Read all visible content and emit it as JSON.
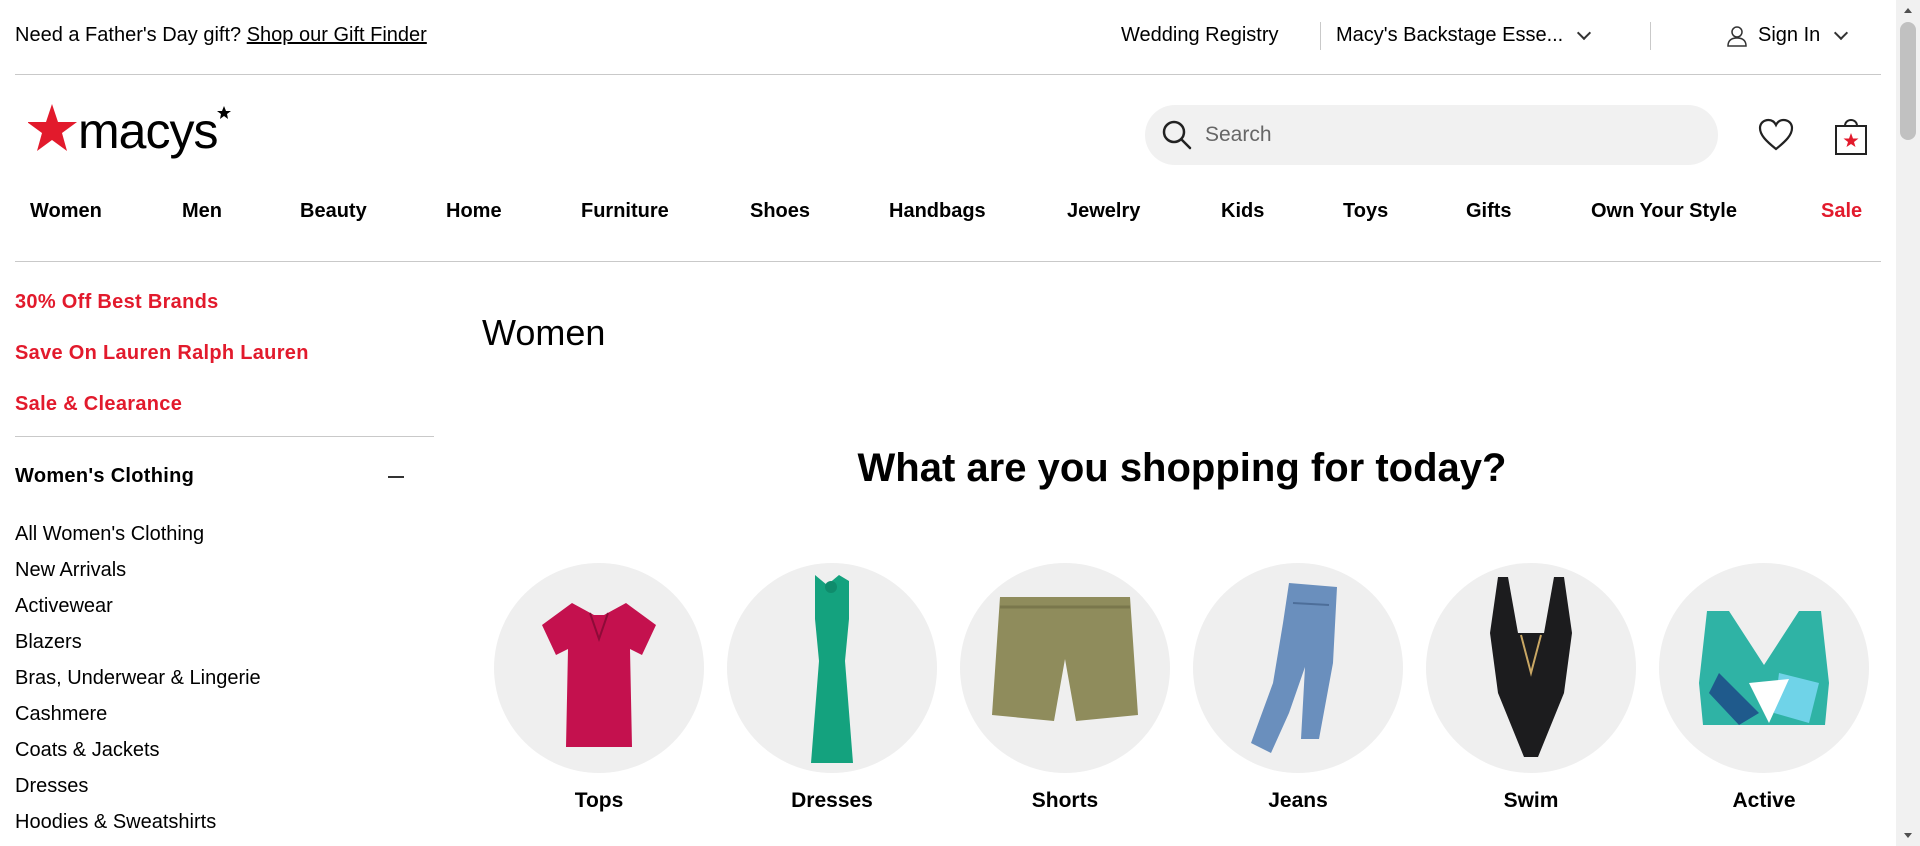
{
  "utility": {
    "promo_text": "Need a Father's Day gift?",
    "promo_link": "Shop our Gift Finder",
    "registry": "Wedding Registry",
    "store": "Macy's Backstage Esse...",
    "signin": "Sign In"
  },
  "header": {
    "search_placeholder": "Search",
    "brand_color": "#e21a2c"
  },
  "nav": [
    "Women",
    "Men",
    "Beauty",
    "Home",
    "Furniture",
    "Shoes",
    "Handbags",
    "Jewelry",
    "Kids",
    "Toys",
    "Gifts",
    "Own Your Style",
    "Sale"
  ],
  "sidebar": {
    "promos": [
      "30% Off Best Brands",
      "Save On Lauren Ralph Lauren",
      "Sale & Clearance"
    ],
    "section_title": "Women's Clothing",
    "links": [
      "All Women's Clothing",
      "New Arrivals",
      "Activewear",
      "Blazers",
      "Bras, Underwear & Lingerie",
      "Cashmere",
      "Coats & Jackets",
      "Dresses",
      "Hoodies & Sweatshirts"
    ]
  },
  "main": {
    "title": "Women",
    "headline": "What are you shopping for today?",
    "categories": [
      {
        "label": "Tops",
        "icon": "top-image"
      },
      {
        "label": "Dresses",
        "icon": "dress-image"
      },
      {
        "label": "Shorts",
        "icon": "shorts-image"
      },
      {
        "label": "Jeans",
        "icon": "jeans-image"
      },
      {
        "label": "Swim",
        "icon": "swimsuit-image"
      },
      {
        "label": "Active",
        "icon": "sports-bra-image"
      }
    ]
  }
}
